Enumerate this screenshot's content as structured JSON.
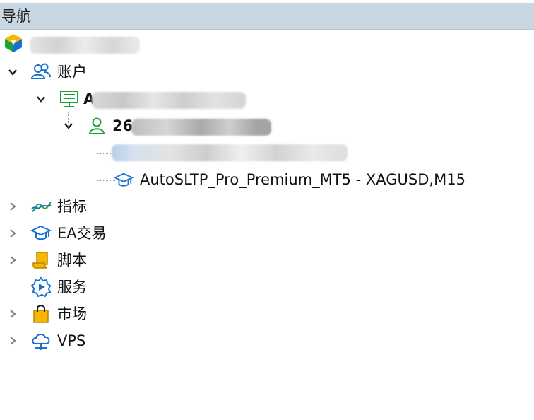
{
  "header": {
    "title": "导航"
  },
  "tree": {
    "root_name": "",
    "accounts_label": "账户",
    "server_name": "A",
    "account_number": "26",
    "chart_name": "",
    "ea_item": "AutoSLTP_Pro_Premium_MT5 - XAGUSD,M15",
    "indicators_label": "指标",
    "ea_label": "EA交易",
    "scripts_label": "脚本",
    "services_label": "服务",
    "market_label": "市场",
    "vps_label": "VPS"
  },
  "icons": {
    "root": "metatrader-logo-icon",
    "accounts": "accounts-people-icon",
    "server": "server-icon",
    "account": "user-account-icon",
    "ea": "graduation-cap-icon",
    "indicators": "indicator-line-icon",
    "scripts": "script-scroll-icon",
    "services": "gear-play-icon",
    "market": "shopping-bag-icon",
    "vps": "cloud-network-icon"
  },
  "colors": {
    "header_bg": "#c9d7e3",
    "icon_blue": "#1b6fd1",
    "icon_green": "#1aa33a",
    "icon_yellow": "#f2b705"
  }
}
